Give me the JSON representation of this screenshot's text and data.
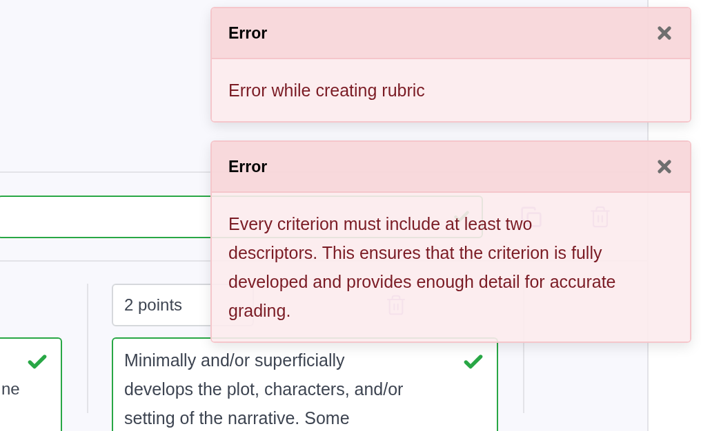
{
  "criterion": {
    "valid": true
  },
  "descriptors": [
    {
      "text": "ne",
      "valid": true
    },
    {
      "points": "2 points",
      "text": "Minimally and/or superficially develops the plot, characters, and/or setting of the narrative. Some",
      "valid": true
    }
  ],
  "toasts": [
    {
      "title": "Error",
      "message": "Error while creating rubric"
    },
    {
      "title": "Error",
      "message": "Every criterion must include at least two descriptors. This ensures that the criterion is fully developed and provides enough detail for accurate grading."
    }
  ]
}
